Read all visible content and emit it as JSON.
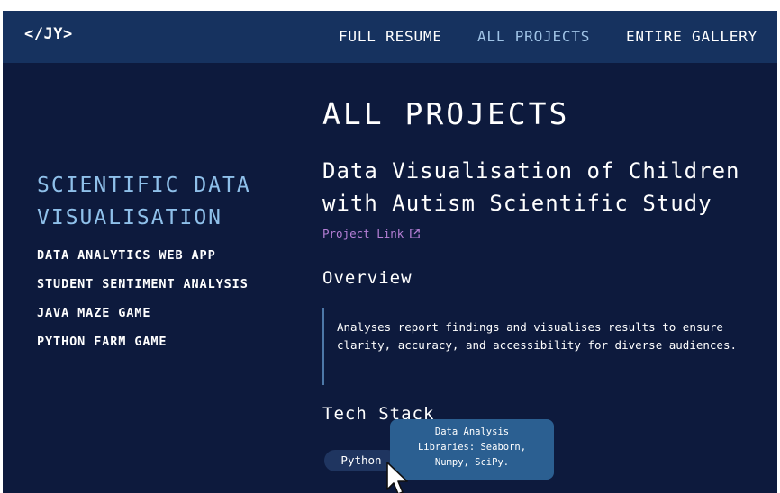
{
  "navbar": {
    "logo": "</JY>",
    "links": [
      {
        "label": "FULL RESUME"
      },
      {
        "label": "ALL PROJECTS"
      },
      {
        "label": "ENTIRE GALLERY"
      }
    ],
    "active_link": "ALL PROJECTS"
  },
  "sidebar": {
    "active_item": "SCIENTIFIC DATA VISUALISATION",
    "items": [
      {
        "label": "DATA ANALYTICS WEB APP"
      },
      {
        "label": "STUDENT SENTIMENT ANALYSIS"
      },
      {
        "label": "JAVA MAZE GAME"
      },
      {
        "label": "PYTHON FARM GAME"
      }
    ]
  },
  "main": {
    "page_title": "ALL PROJECTS",
    "project_title": "Data Visualisation of Children with Autism Scientific Study",
    "project_link_label": "Project Link",
    "overview_heading": "Overview",
    "overview_text": "Analyses report findings and visualises results to ensure clarity, accuracy, and accessibility for diverse audiences.",
    "tech_stack_heading": "Tech Stack",
    "tech_stack": [
      {
        "label": "Python"
      }
    ],
    "tooltip_lines": [
      "Data Analysis",
      "Libraries: Seaborn,",
      "Numpy, SciPy."
    ]
  },
  "colors": {
    "background": "#0d1a3d",
    "navbar": "#16325f",
    "accent_blue": "#8fc0ea",
    "link_purple": "#b57fd6",
    "tooltip": "#2b5f91"
  },
  "icons": {
    "project_link": "external-link-icon",
    "pointer": "cursor-arrow-icon"
  }
}
